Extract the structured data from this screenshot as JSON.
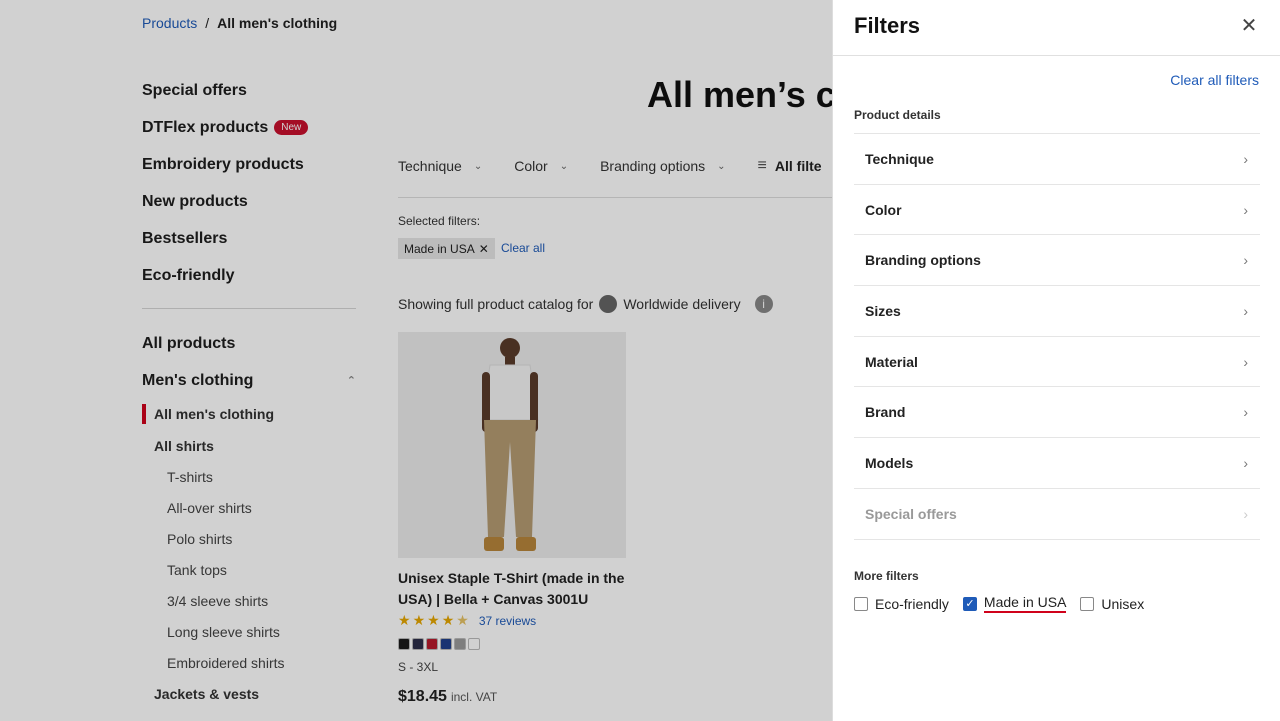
{
  "breadcrumb": {
    "parent": "Products",
    "separator": "/",
    "current": "All men's clothing"
  },
  "sidebar": {
    "main_items": [
      {
        "label": "Special offers"
      },
      {
        "label": "DTFlex products",
        "badge": "New"
      },
      {
        "label": "Embroidery products"
      },
      {
        "label": "New products"
      },
      {
        "label": "Bestsellers"
      },
      {
        "label": "Eco-friendly"
      }
    ],
    "all_products": "All products",
    "mens_clothing": "Men's clothing",
    "sub_items": [
      {
        "label": "All men's clothing",
        "level": 1,
        "active": true
      },
      {
        "label": "All shirts",
        "level": 1
      },
      {
        "label": "T-shirts",
        "level": 2
      },
      {
        "label": "All-over shirts",
        "level": 2
      },
      {
        "label": "Polo shirts",
        "level": 2
      },
      {
        "label": "Tank tops",
        "level": 2
      },
      {
        "label": "3/4 sleeve shirts",
        "level": 2
      },
      {
        "label": "Long sleeve shirts",
        "level": 2
      },
      {
        "label": "Embroidered shirts",
        "level": 2
      },
      {
        "label": "Jackets & vests",
        "level": 1
      }
    ]
  },
  "main": {
    "title": "All men’s cloth",
    "filters": {
      "technique": "Technique",
      "color": "Color",
      "branding": "Branding options",
      "all_filters": "All filte"
    },
    "selected_label": "Selected filters:",
    "chip": "Made in USA",
    "clear_all": "Clear all",
    "catalog_prefix": "Showing full product catalog for",
    "catalog_region": "Worldwide delivery"
  },
  "product": {
    "title": "Unisex Staple T-Shirt (made in the USA) | Bella + Canvas 3001U",
    "rating": 4.5,
    "reviews": "37 reviews",
    "swatch_colors": [
      "#1a1a1a",
      "#2d2f4a",
      "#b71c2c",
      "#1f3f8c",
      "#9a9a9a",
      "#ffffff"
    ],
    "sizes": "S - 3XL",
    "price": "$18.45",
    "vat": "incl. VAT"
  },
  "drawer": {
    "title": "Filters",
    "clear_all_filters": "Clear all filters",
    "product_details_label": "Product details",
    "filters": [
      {
        "label": "Technique"
      },
      {
        "label": "Color"
      },
      {
        "label": "Branding options"
      },
      {
        "label": "Sizes"
      },
      {
        "label": "Material"
      },
      {
        "label": "Brand"
      },
      {
        "label": "Models"
      },
      {
        "label": "Special offers",
        "disabled": true
      }
    ],
    "more_filters_label": "More filters",
    "checkboxes": [
      {
        "label": "Eco-friendly",
        "checked": false
      },
      {
        "label": "Made in USA",
        "checked": true
      },
      {
        "label": "Unisex",
        "checked": false
      }
    ]
  }
}
